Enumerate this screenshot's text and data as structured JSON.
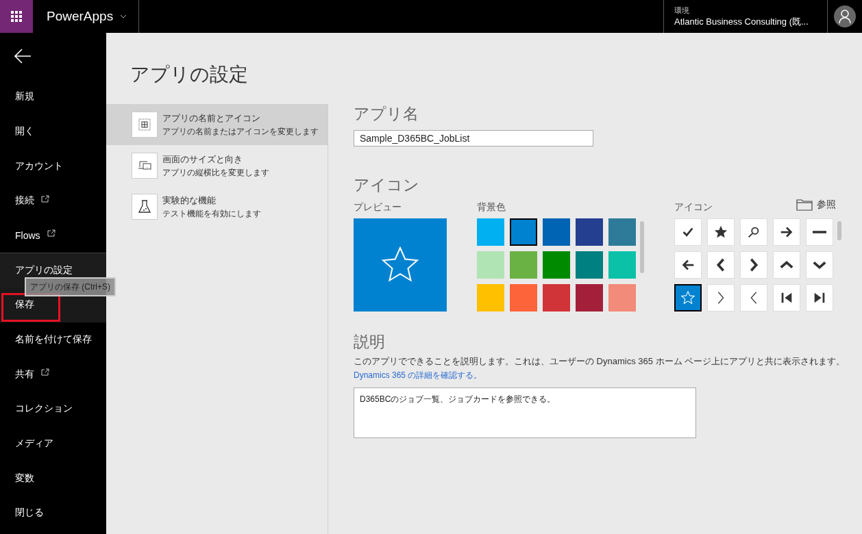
{
  "top_bar": {
    "app_name": "PowerApps",
    "environment_label": "環境",
    "environment": "Atlantic Business Consulting (既..."
  },
  "sidebar": {
    "items": [
      {
        "label": "新規",
        "selected": false,
        "external": false,
        "highlighted": false
      },
      {
        "label": "開く",
        "selected": false,
        "external": false,
        "highlighted": false
      },
      {
        "label": "アカウント",
        "selected": false,
        "external": false,
        "highlighted": false
      },
      {
        "label": "接続",
        "selected": false,
        "external": true,
        "highlighted": false
      },
      {
        "label": "Flows",
        "selected": false,
        "external": true,
        "highlighted": false
      },
      {
        "label": "アプリの設定",
        "selected": true,
        "external": false,
        "highlighted": false
      },
      {
        "label": "保存",
        "selected": false,
        "external": false,
        "highlighted": true
      },
      {
        "label": "名前を付けて保存",
        "selected": false,
        "external": false,
        "highlighted": false
      },
      {
        "label": "共有",
        "selected": false,
        "external": true,
        "highlighted": false
      },
      {
        "label": "コレクション",
        "selected": false,
        "external": false,
        "highlighted": false
      },
      {
        "label": "メディア",
        "selected": false,
        "external": false,
        "highlighted": false
      },
      {
        "label": "変数",
        "selected": false,
        "external": false,
        "highlighted": false
      },
      {
        "label": "閉じる",
        "selected": false,
        "external": false,
        "highlighted": false
      }
    ],
    "tooltip": "アプリの保存 (Ctrl+S)"
  },
  "page_title": "アプリの設定",
  "settings_nav": [
    {
      "kind": "name",
      "title": "アプリの名前とアイコン",
      "subtitle": "アプリの名前またはアイコンを変更します",
      "selected": true
    },
    {
      "kind": "screen",
      "title": "画面のサイズと向き",
      "subtitle": "アプリの縦横比を変更します",
      "selected": false
    },
    {
      "kind": "experimental",
      "title": "実験的な機能",
      "subtitle": "テスト機能を有効にします",
      "selected": false
    }
  ],
  "app_name": {
    "heading": "アプリ名",
    "value": "Sample_D365BC_JobList"
  },
  "icon_section": {
    "heading": "アイコン",
    "preview_label": "プレビュー",
    "background_label": "背景色",
    "icon_label": "アイコン",
    "browse": "参照",
    "colors": [
      {
        "color": "#00b0f0",
        "selected": false
      },
      {
        "color": "#0082d0",
        "selected": true
      },
      {
        "color": "#0064b4",
        "selected": false
      },
      {
        "color": "#243f8f",
        "selected": false
      },
      {
        "color": "#2e7b99",
        "selected": false
      },
      {
        "color": "#b0e4b4",
        "selected": false
      },
      {
        "color": "#6bb245",
        "selected": false
      },
      {
        "color": "#008a00",
        "selected": false
      },
      {
        "color": "#008080",
        "selected": false
      },
      {
        "color": "#0bc2a8",
        "selected": false
      },
      {
        "color": "#ffc000",
        "selected": false
      },
      {
        "color": "#fd6439",
        "selected": false
      },
      {
        "color": "#d13438",
        "selected": false
      },
      {
        "color": "#a4203a",
        "selected": false
      },
      {
        "color": "#f28b79",
        "selected": false
      }
    ],
    "icons": [
      {
        "kind": "check",
        "selected": false
      },
      {
        "kind": "star",
        "selected": false
      },
      {
        "kind": "search",
        "selected": false
      },
      {
        "kind": "right-arrow",
        "selected": false
      },
      {
        "kind": "minus",
        "selected": false
      },
      {
        "kind": "left-arrow",
        "selected": false
      },
      {
        "kind": "left-chevron",
        "selected": false
      },
      {
        "kind": "right-chevron",
        "selected": false
      },
      {
        "kind": "up-chevron",
        "selected": false
      },
      {
        "kind": "down-chevron",
        "selected": false
      },
      {
        "kind": "star-outline",
        "selected": true
      },
      {
        "kind": "thin-right-chevron",
        "selected": false
      },
      {
        "kind": "thin-left-chevron",
        "selected": false
      },
      {
        "kind": "skip-back",
        "selected": false
      },
      {
        "kind": "skip-forward",
        "selected": false
      }
    ]
  },
  "description": {
    "heading": "説明",
    "text": "このアプリでできることを説明します。これは、ユーザーの Dynamics 365 ホーム ページ上にアプリと共に表示されます。",
    "link": "Dynamics 365 の詳細を確認する。",
    "value": "D365BCのジョブ一覧、ジョブカードを参照できる。"
  }
}
